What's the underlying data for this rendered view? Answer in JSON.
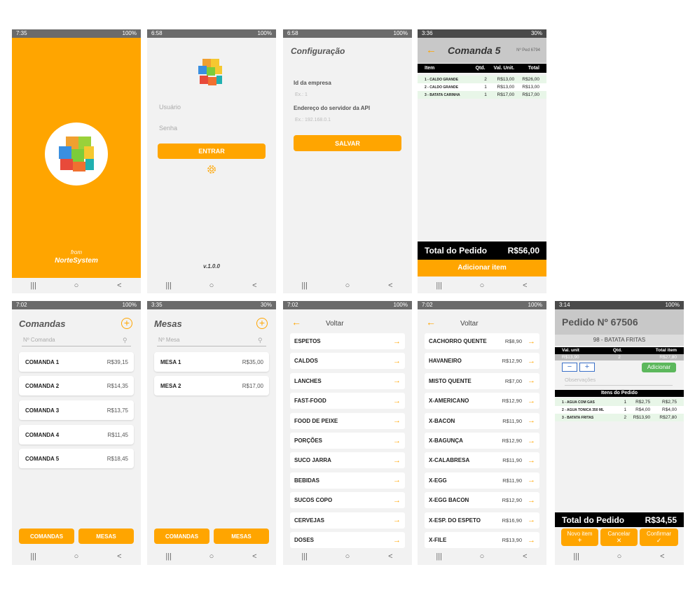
{
  "colors": {
    "accent": "#ffa500",
    "dark": "#000000",
    "green": "#5cb85c"
  },
  "icons": {
    "search": "search-icon",
    "settings": "gear-icon",
    "back": "arrow-left-icon",
    "add": "plus-circle-icon",
    "next": "arrow-right-icon"
  },
  "nav": {
    "recents": "|||",
    "home": "○",
    "back": "<"
  },
  "s1": {
    "time": "7:35",
    "status": "100%",
    "from": "from",
    "brand": "NorteSystem"
  },
  "s2": {
    "time": "6:58",
    "status": "100%",
    "user_ph": "Usuário",
    "pass_ph": "Senha",
    "login": "ENTRAR",
    "version": "v.1.0.0"
  },
  "s3": {
    "time": "6:58",
    "status": "100%",
    "title": "Configuração",
    "company_label": "Id da empresa",
    "company_ph": "Ex.: 1",
    "server_label": "Endereço do servidor da API",
    "server_ph": "Ex.: 192.168.0.1",
    "save": "SALVAR"
  },
  "s4": {
    "time": "3:36",
    "status": "30%",
    "title": "Comanda 5",
    "order_no": "Nº Ped 6794",
    "cols": [
      "Item",
      "Qtd.",
      "Val. Unit.",
      "Total"
    ],
    "rows": [
      [
        "1 - CALDO GRANDE",
        "2",
        "R$13,00",
        "R$26,00"
      ],
      [
        "2 - CALDO GRANDE",
        "1",
        "R$13,00",
        "R$13,00"
      ],
      [
        "3 - BATATA CARINHA",
        "1",
        "R$17,00",
        "R$17,00"
      ]
    ],
    "total_label": "Total do Pedido",
    "total": "R$56,00",
    "add": "Adicionar item"
  },
  "s5": {
    "time": "7:02",
    "status": "100%",
    "title": "Comandas",
    "search_ph": "Nº Comanda",
    "items": [
      {
        "n": "COMANDA 1",
        "v": "R$39,15"
      },
      {
        "n": "COMANDA 2",
        "v": "R$14,35"
      },
      {
        "n": "COMANDA 3",
        "v": "R$13,75"
      },
      {
        "n": "COMANDA 4",
        "v": "R$11,45"
      },
      {
        "n": "COMANDA 5",
        "v": "R$18,45"
      }
    ],
    "btn1": "COMANDAS",
    "btn2": "MESAS"
  },
  "s6": {
    "time": "3:35",
    "status": "30%",
    "title": "Mesas",
    "search_ph": "Nº Mesa",
    "items": [
      {
        "n": "MESA 1",
        "v": "R$35,00"
      },
      {
        "n": "MESA 2",
        "v": "R$17,00"
      }
    ],
    "btn1": "COMANDAS",
    "btn2": "MESAS"
  },
  "s7": {
    "time": "7:02",
    "status": "100%",
    "back": "Voltar",
    "items": [
      "ESPETOS",
      "CALDOS",
      "LANCHES",
      "FAST-FOOD",
      "FOOD DE PEIXE",
      "PORÇÕES",
      "SUCO JARRA",
      "BEBIDAS",
      "SUCOS COPO",
      "CERVEJAS",
      "DOSES"
    ]
  },
  "s8": {
    "time": "7:02",
    "status": "100%",
    "back": "Voltar",
    "items": [
      {
        "n": "CACHORRO QUENTE",
        "v": "R$8,90"
      },
      {
        "n": "HAVANEIRO",
        "v": "R$12,90"
      },
      {
        "n": "MISTO QUENTE",
        "v": "R$7,00"
      },
      {
        "n": "X-AMERICANO",
        "v": "R$12,90"
      },
      {
        "n": "X-BACON",
        "v": "R$11,90"
      },
      {
        "n": "X-BAGUNÇA",
        "v": "R$12,90"
      },
      {
        "n": "X-CALABRESA",
        "v": "R$11,90"
      },
      {
        "n": "X-EGG",
        "v": "R$11,90"
      },
      {
        "n": "X-EGG BACON",
        "v": "R$12,90"
      },
      {
        "n": "X-ESP. DO ESPETO",
        "v": "R$16,90"
      },
      {
        "n": "X-FILE",
        "v": "R$13,90"
      }
    ]
  },
  "s9": {
    "time": "3:14",
    "status": "100%",
    "title": "Pedido Nº 67506",
    "product": "98 - BATATA FRITAS",
    "cols": [
      "Val. unit",
      "Qtd.",
      "Total item"
    ],
    "vals": [
      "R$13,90",
      "2",
      "R$27,80"
    ],
    "minus": "−",
    "plus": "+",
    "add": "Adicionar",
    "obs_ph": "Observações",
    "items_title": "Itens do Pedido",
    "rows": [
      [
        "1 - AGUA COM GAS",
        "1",
        "R$2,75",
        "R$2,75"
      ],
      [
        "2 - AGUA TONICA 350 ML",
        "1",
        "R$4,00",
        "R$4,00"
      ],
      [
        "3 - BATATA FRITAS",
        "2",
        "R$13,90",
        "R$27,80"
      ]
    ],
    "total_label": "Total do Pedido",
    "total": "R$34,55",
    "btn_new": "Novo item",
    "btn_new_icon": "+",
    "btn_cancel": "Cancelar",
    "btn_cancel_icon": "✕",
    "btn_confirm": "Confirmar",
    "btn_confirm_icon": "✓"
  }
}
